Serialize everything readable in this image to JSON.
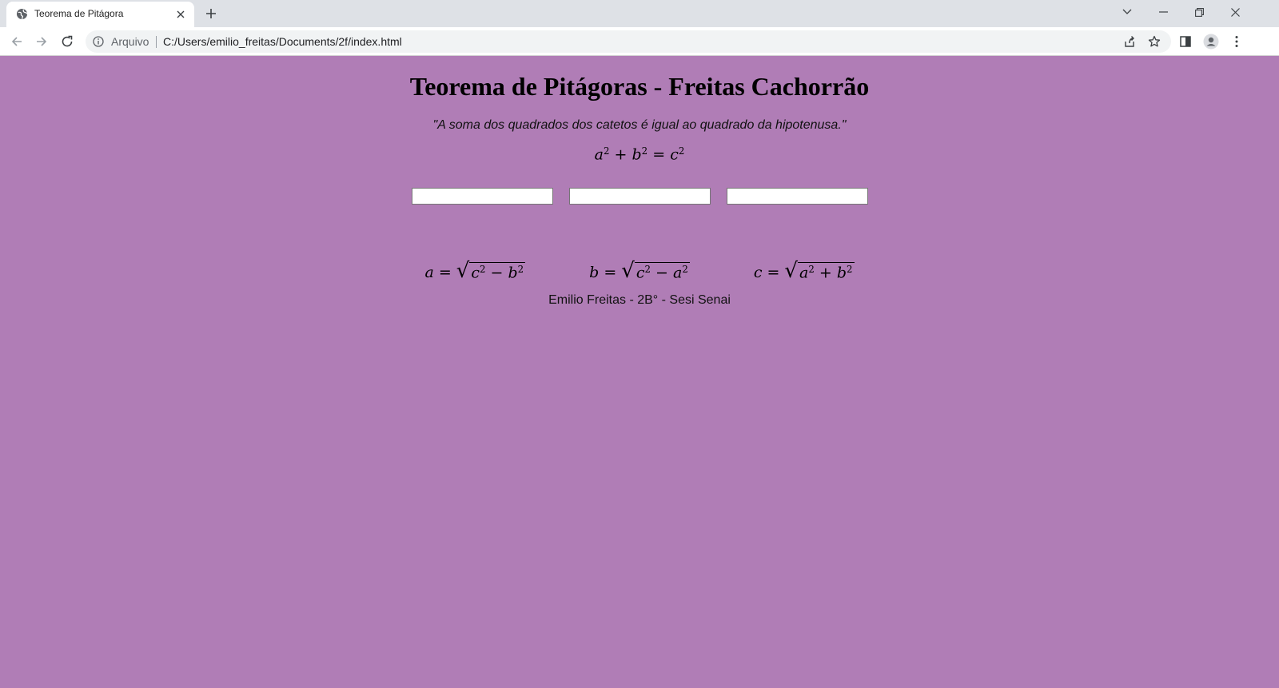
{
  "browser": {
    "tab_title": "Teorema de Pitágora",
    "secure_label": "Arquivo",
    "url": "C:/Users/emilio_freitas/Documents/2f/index.html"
  },
  "page": {
    "title": "Teorema de Pitágoras - Freitas Cachorrão",
    "quote": "\"A soma dos quadrados dos catetos é igual ao quadrado da hipotenusa.\"",
    "main_formula": {
      "a": "a",
      "b": "b",
      "c": "c",
      "exp": "2",
      "plus": "+",
      "equals": "="
    },
    "inputs": [
      {
        "value": "",
        "placeholder": ""
      },
      {
        "value": "",
        "placeholder": ""
      },
      {
        "value": "",
        "placeholder": ""
      }
    ],
    "formulas": [
      {
        "lhs": "a",
        "equals": "=",
        "x": "c",
        "op": "−",
        "y": "b",
        "exp": "2"
      },
      {
        "lhs": "b",
        "equals": "=",
        "x": "c",
        "op": "−",
        "y": "a",
        "exp": "2"
      },
      {
        "lhs": "c",
        "equals": "=",
        "x": "a",
        "op": "+",
        "y": "b",
        "exp": "2"
      }
    ],
    "footer": "Emilio Freitas - 2B° - Sesi Senai"
  },
  "colors": {
    "page_background": "#b07db6",
    "tabstrip": "#dee1e6"
  }
}
